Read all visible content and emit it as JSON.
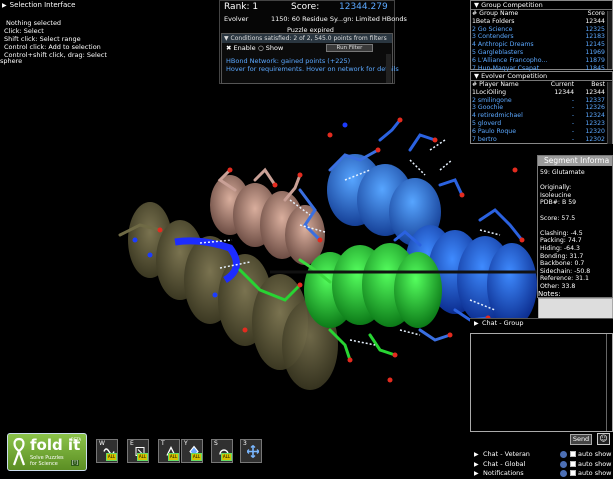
{
  "selection": {
    "title": "Selection Interface",
    "lines": [
      "Nothing selected",
      "Click: Select",
      "Shift click: Select range",
      "Control click: Add to selection",
      "Control+shift click, drag: Select",
      "sphere"
    ]
  },
  "score": {
    "rank_label": "Rank: 1",
    "score_label": "Score:",
    "score_value": "12344.279",
    "player": "Evolver",
    "puzzle": "1150: 60 Residue Sy...gn: Limited HBonds",
    "status": "Puzzle expired"
  },
  "conditions": {
    "header": "Conditions satisfied: 2 of 2, 545.0 points from filters",
    "enable_label": "Enable",
    "show_label": "Show",
    "run_filter_label": "Run Filter",
    "msg1": "HBond Network: gained points (+225)",
    "msg2": "Hover for requirements. Hover on network for details"
  },
  "group_competition": {
    "title": "Group Competition",
    "columns": [
      "# Group Name",
      "Score"
    ],
    "rows": [
      {
        "name": "1Beta Folders",
        "score": "12344",
        "highlight": false
      },
      {
        "name": "2 Go Science",
        "score": "12325",
        "highlight": true
      },
      {
        "name": "3 Contenders",
        "score": "12183",
        "highlight": true
      },
      {
        "name": "4 Anthropic Dreams",
        "score": "12145",
        "highlight": true
      },
      {
        "name": "5 Gargleblasters",
        "score": "11969",
        "highlight": true
      },
      {
        "name": "6 L'Alliance Francopho...",
        "score": "11879",
        "highlight": true
      },
      {
        "name": "7 Hun-Magyar Csapat",
        "score": "11845",
        "highlight": true
      }
    ]
  },
  "evolver_competition": {
    "title": "Evolver Competition",
    "columns": [
      "# Player Name",
      "Current",
      "Best"
    ],
    "rows": [
      {
        "name": "1LociOiling",
        "current": "12344",
        "best": "12344",
        "highlight": false
      },
      {
        "name": "2 smilingone",
        "current": "-",
        "best": "12337",
        "highlight": true
      },
      {
        "name": "3 Goochie",
        "current": "-",
        "best": "12326",
        "highlight": true
      },
      {
        "name": "4 retiredmichael",
        "current": "-",
        "best": "12324",
        "highlight": true
      },
      {
        "name": "5 gloverd",
        "current": "-",
        "best": "12323",
        "highlight": true
      },
      {
        "name": "6 Paulo Roque",
        "current": "-",
        "best": "12320",
        "highlight": true
      },
      {
        "name": "7 bertro",
        "current": "-",
        "best": "12302",
        "highlight": true
      }
    ]
  },
  "segment": {
    "title": "Segment Informa",
    "lines": [
      "59: Glutamate",
      "",
      "Originally:",
      "Isoleucine",
      "PDB#: B 59",
      "",
      "Score: 57.5",
      "",
      "Clashing: -4.5",
      "Packing: 74.7",
      "Hiding: -64.3",
      "Bonding: 31.7",
      "Backbone: 0.7",
      "Sidechain: -50.8",
      "Reference: 31.1",
      "Other: 33.8"
    ],
    "notes_label": "Notes:"
  },
  "chat": {
    "group_tab": "Chat - Group",
    "send_label": "Send",
    "help_glyph": "☺",
    "channels": [
      {
        "label": "Chat - Veteran",
        "auto": "auto show"
      },
      {
        "label": "Chat - Global",
        "auto": "auto show"
      },
      {
        "label": "Notifications",
        "auto": "auto show"
      }
    ]
  },
  "logo": {
    "word": "fold it",
    "beta": "BETA",
    "sub1": "Solve Puzzles",
    "sub2": "for Science",
    "badge": "[!]"
  },
  "tools": [
    {
      "key": "W",
      "name": "wiggle",
      "all_label": "ALL"
    },
    {
      "key": "E",
      "name": "shake",
      "all_label": "ALL"
    },
    {
      "key": "T",
      "name": "tweak",
      "all_label": "ALL"
    },
    {
      "key": "Y",
      "name": "mutate",
      "all_label": "ALL"
    },
    {
      "key": "S",
      "name": "rebuild",
      "all_label": "ALL"
    },
    {
      "key": "3",
      "name": "move",
      "all_label": ""
    }
  ],
  "colors": {
    "blue_text": "#5ba8ff",
    "helix_olive": "#5f5a3a",
    "helix_pink": "#c79b8c",
    "helix_blue": "#2f7ff0",
    "helix_green": "#2fe03a"
  }
}
